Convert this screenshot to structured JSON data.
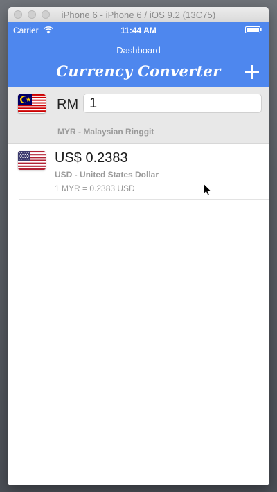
{
  "simulator": {
    "title": "iPhone 6 - iPhone 6 / iOS 9.2 (13C75)"
  },
  "status_bar": {
    "carrier": "Carrier",
    "time": "11:44 AM"
  },
  "nav": {
    "prompt": "Dashboard",
    "title": "Currency Converter",
    "add_icon": "plus-icon"
  },
  "base_currency": {
    "flag_icon": "malaysia-flag-icon",
    "symbol": "RM",
    "amount": "1",
    "name": "MYR - Malaysian Ringgit"
  },
  "converted": [
    {
      "flag_icon": "usa-flag-icon",
      "amount": "US$ 0.2383",
      "name": "USD - United States Dollar",
      "rate": "1 MYR = 0.2383 USD"
    }
  ],
  "colors": {
    "nav_background": "#4e87ee",
    "base_section_background": "#e8e8e8",
    "secondary_text": "#9a9a9a"
  }
}
